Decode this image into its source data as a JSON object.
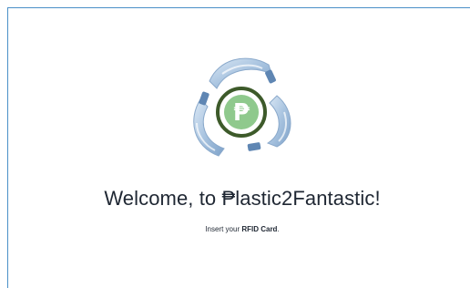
{
  "logo": {
    "icon": "recycle-bottles-peso-icon",
    "symbol": "₱",
    "colors": {
      "bottle": "#a9c4e0",
      "bottle_dark": "#6d91b9",
      "ring": "#3d5a2a",
      "coin": "#8fc98d"
    }
  },
  "welcome": {
    "prefix": "Welcome, to ",
    "brand": "₱lastic2Fantastic!"
  },
  "instruction": {
    "before": "Insert your ",
    "emphasis": "RFID Card",
    "after": "."
  },
  "colors": {
    "frame_border": "#4a90c8",
    "text": "#1f2733",
    "background": "#ffffff"
  }
}
